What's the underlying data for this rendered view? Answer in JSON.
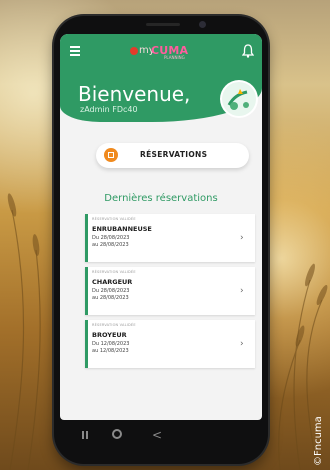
{
  "colors": {
    "accent_green": "#2f9a64",
    "reservation_orange": "#f08a1e",
    "logo_pink": "#ff5d9e"
  },
  "app": {
    "logo_my": "my",
    "logo_cuma": "CUMA",
    "logo_sub": "PLANNING",
    "menu_icon": "hamburger-icon",
    "notification_icon": "bell-icon"
  },
  "header": {
    "welcome": "Bienvenue,",
    "user": "zAdmin FDc40"
  },
  "reservations_button": {
    "label": "RÉSERVATIONS",
    "icon": "calendar-icon"
  },
  "section_title": "Dernières réservations",
  "cards": [
    {
      "tag": "RÉSERVATION VALIDÉE",
      "name": "ENRUBANNEUSE",
      "line1": "Du 28/08/2023",
      "line2": "au 28/08/2023"
    },
    {
      "tag": "RÉSERVATION VALIDÉE",
      "name": "CHARGEUR",
      "line1": "Du 28/08/2023",
      "line2": "au 28/08/2023"
    },
    {
      "tag": "RÉSERVATION VALIDÉE",
      "name": "BROYEUR",
      "line1": "Du 12/08/2023",
      "line2": "au 12/08/2023"
    }
  ],
  "nav": {
    "back_icon": "recent-apps-icon",
    "home_icon": "home-icon",
    "return_icon": "back-icon"
  },
  "copyright": "©Fncuma"
}
